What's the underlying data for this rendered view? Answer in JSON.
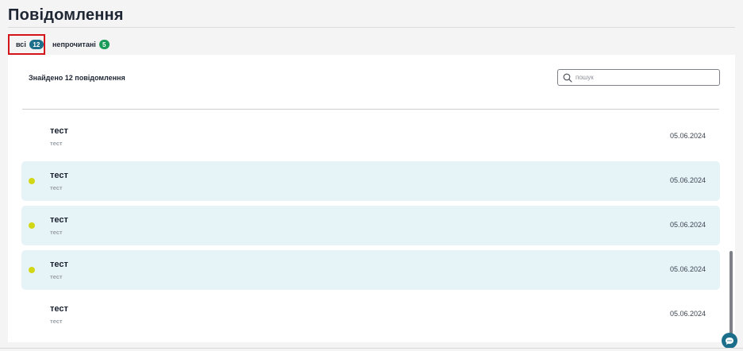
{
  "page": {
    "title": "Повідомлення"
  },
  "tabs": [
    {
      "label": "всі",
      "count": "12",
      "active": true
    },
    {
      "label": "непрочитані",
      "count": "5",
      "active": false
    }
  ],
  "list_header": {
    "found_text": "Знайдено 12 повідомлення"
  },
  "search": {
    "placeholder": "пошук",
    "value": ""
  },
  "messages": [
    {
      "title": "тест",
      "subtitle": "тест",
      "date": "05.06.2024",
      "unread": false
    },
    {
      "title": "тест",
      "subtitle": "тест",
      "date": "05.06.2024",
      "unread": true
    },
    {
      "title": "тест",
      "subtitle": "тест",
      "date": "05.06.2024",
      "unread": true
    },
    {
      "title": "тест",
      "subtitle": "тест",
      "date": "05.06.2024",
      "unread": true
    },
    {
      "title": "тест",
      "subtitle": "тест",
      "date": "05.06.2024",
      "unread": false
    }
  ],
  "colors": {
    "unread_row_bg": "#e6f4f8",
    "unread_dot": "#d2d816",
    "count_badge_all": "#1b6f8a",
    "count_badge_unread": "#1a9b57",
    "active_tab_outline": "#d4141a",
    "chat_button": "#1b6f8a"
  },
  "icons": {
    "search": "search-icon",
    "chat": "chat-bubble-icon"
  }
}
